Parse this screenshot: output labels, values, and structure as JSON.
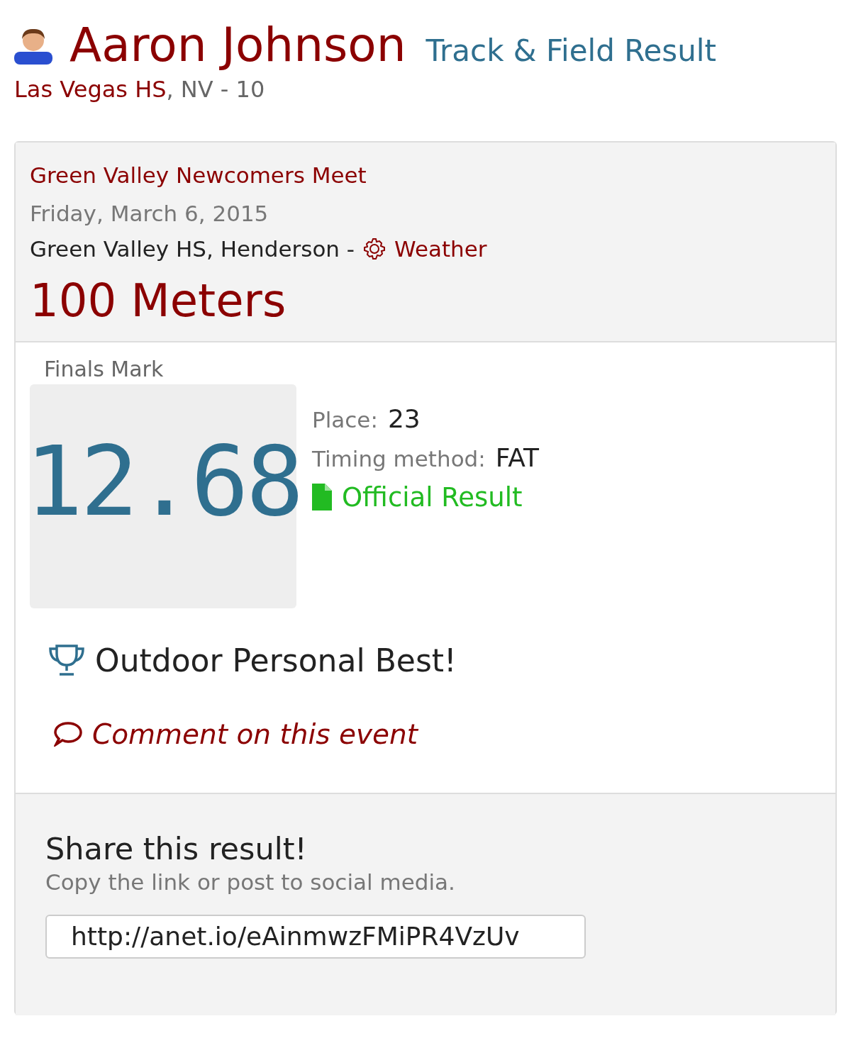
{
  "athlete": {
    "name": "Aaron Johnson",
    "page_title": "Track & Field Result",
    "school": "Las Vegas HS",
    "location_grade": ", NV - 10"
  },
  "meet": {
    "name": "Green Valley Newcomers Meet",
    "date": "Friday, March 6, 2015",
    "venue": "Green Valley HS, Henderson -",
    "weather_link": "Weather",
    "event": "100 Meters"
  },
  "result": {
    "mark_label": "Finals Mark",
    "mark": "12.68",
    "place_label": "Place:",
    "place": "23",
    "timing_label": "Timing method:",
    "timing": "FAT",
    "official_link": "Official Result",
    "personal_best": "Outdoor Personal Best!",
    "comment_link": "Comment on this event"
  },
  "share": {
    "title": "Share this result!",
    "subtitle": "Copy the link or post to social media.",
    "url": "http://anet.io/eAinmwzFMiPR4VzUv"
  }
}
